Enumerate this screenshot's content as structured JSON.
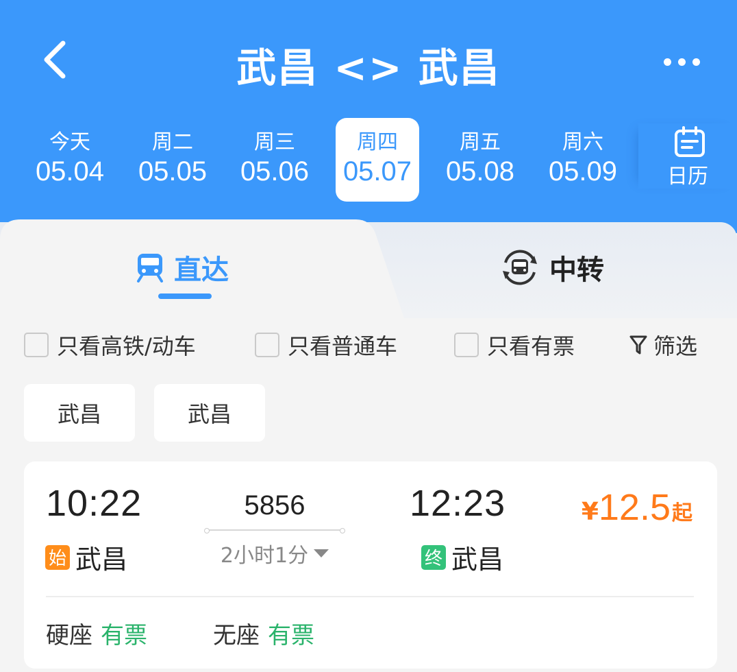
{
  "header": {
    "title": "武昌 <> 武昌",
    "bg_color": "#3b98fb"
  },
  "dates": [
    {
      "dow": "今天",
      "date": "05.04",
      "active": false
    },
    {
      "dow": "周二",
      "date": "05.05",
      "active": false
    },
    {
      "dow": "周三",
      "date": "05.06",
      "active": false
    },
    {
      "dow": "周四",
      "date": "05.07",
      "active": true
    },
    {
      "dow": "周五",
      "date": "05.08",
      "active": false
    },
    {
      "dow": "周六",
      "date": "05.09",
      "active": false
    }
  ],
  "calendar": {
    "label": "日历",
    "icon": "calendar-icon"
  },
  "tabs": {
    "direct": {
      "label": "直达",
      "icon": "train-icon"
    },
    "transfer": {
      "label": "中转",
      "icon": "transfer-train-icon"
    }
  },
  "filters": {
    "high_speed": "只看高铁/动车",
    "ordinary": "只看普通车",
    "available": "只看有票",
    "filter_label": "筛选",
    "filter_icon": "funnel-icon"
  },
  "station_chips": [
    "武昌",
    "武昌"
  ],
  "train": {
    "dep_time": "10:22",
    "arr_time": "12:23",
    "number": "5856",
    "duration": "2小时1分",
    "dep_badge": "始",
    "dep_station": "武昌",
    "arr_badge": "终",
    "arr_station": "武昌",
    "price_currency": "¥",
    "price_amount": "12.5",
    "price_suffix": "起",
    "seats": [
      {
        "type": "硬座",
        "status": "有票"
      },
      {
        "type": "无座",
        "status": "有票"
      }
    ]
  },
  "colors": {
    "accent": "#3b98fb",
    "price": "#ff7a1a",
    "available": "#2ab36b",
    "start_badge": "#ff8d1a",
    "end_badge": "#33c27a"
  }
}
